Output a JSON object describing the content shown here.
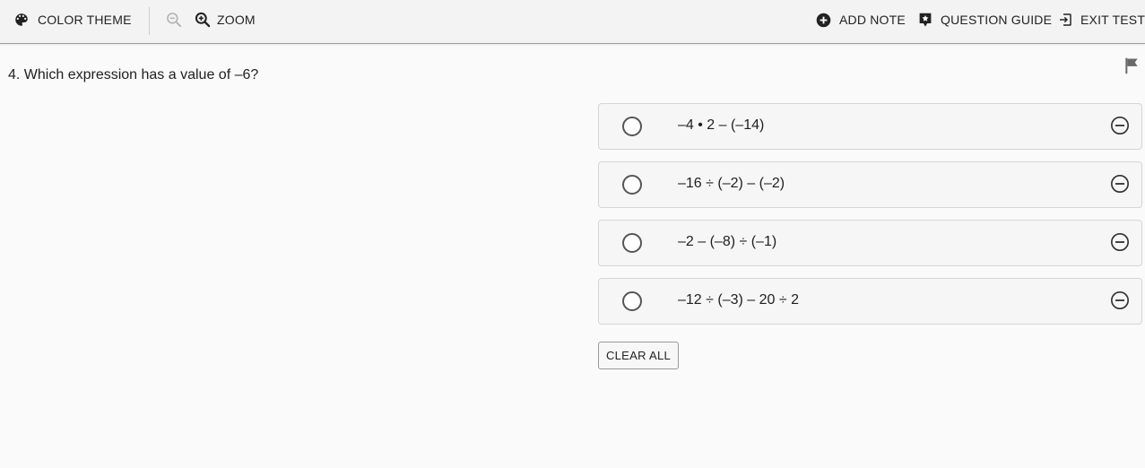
{
  "toolbar": {
    "color_theme_label": "COLOR THEME",
    "color_theme_icon": "palette-icon",
    "zoom_out_icon": "zoom-out-icon",
    "zoom_label": "ZOOM",
    "zoom_in_icon": "zoom-in-icon",
    "add_note_label": "ADD NOTE",
    "add_note_icon": "add-note-icon",
    "question_guide_label": "QUESTION GUIDE",
    "question_guide_icon": "question-guide-icon",
    "exit_test_label": "EXIT TEST",
    "exit_test_icon": "exit-icon"
  },
  "question": {
    "text": "4. Which expression has a value of –6?",
    "flag_icon": "flag-icon"
  },
  "options": [
    {
      "text": "–4 • 2 – (–14)",
      "selected": false
    },
    {
      "text": "–16 ÷ (–2) – (–2)",
      "selected": false
    },
    {
      "text": "–2 – (–8) ÷ (–1)",
      "selected": false
    },
    {
      "text": "–12 ÷ (–3) – 20 ÷ 2",
      "selected": false
    }
  ],
  "clear_all_label": "CLEAR ALL",
  "colors": {
    "toolbar_bg": "#f3f3f3",
    "page_bg": "#fafafa",
    "option_bg": "#f6f6f6",
    "option_border": "#d6d6d6",
    "icon_dark": "#222222"
  }
}
